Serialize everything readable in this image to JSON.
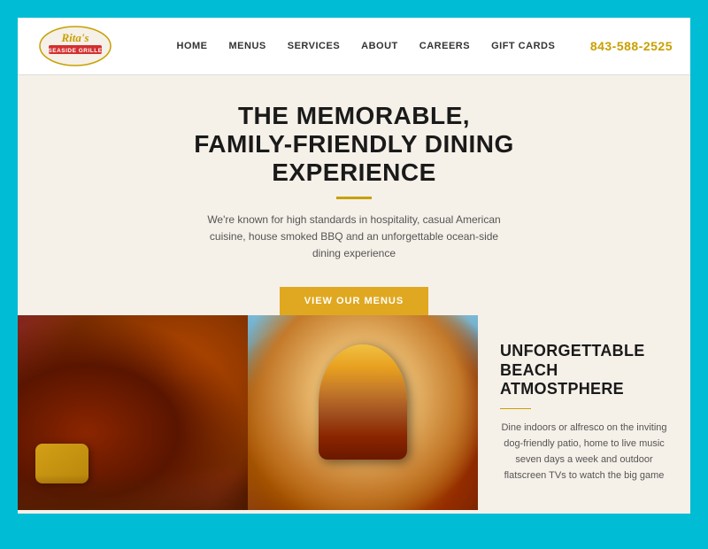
{
  "page": {
    "background_color": "#00bcd4"
  },
  "header": {
    "logo_alt": "Rita's Seaside Grille",
    "phone": "843-588-2525",
    "nav": [
      {
        "label": "HOME",
        "id": "home"
      },
      {
        "label": "MENUS",
        "id": "menus"
      },
      {
        "label": "SERVICES",
        "id": "services"
      },
      {
        "label": "ABOUT",
        "id": "about"
      },
      {
        "label": "CAREERS",
        "id": "careers"
      },
      {
        "label": "GIFT CARDS",
        "id": "gift-cards"
      }
    ]
  },
  "hero": {
    "title_line1": "THE MEMORABLE,",
    "title_line2": "FAMILY-FRIENDLY DINING",
    "title_line3": "EXPERIENCE",
    "description": "We're known for high standards in hospitality, casual American cuisine, house smoked BBQ and an unforgettable ocean-side dining experience",
    "cta_label": "VIEW OUR MENUS"
  },
  "info_panel": {
    "title_line1": "UNFORGETTABLE",
    "title_line2": "BEACH ATMOSTPHERE",
    "description": "Dine indoors or alfresco on the inviting dog-friendly patio, home to live music seven days a week and outdoor flatscreen TVs to watch the big game"
  },
  "images": {
    "left_alt": "Wings and BBQ food",
    "right_alt": "Stacked burger"
  }
}
